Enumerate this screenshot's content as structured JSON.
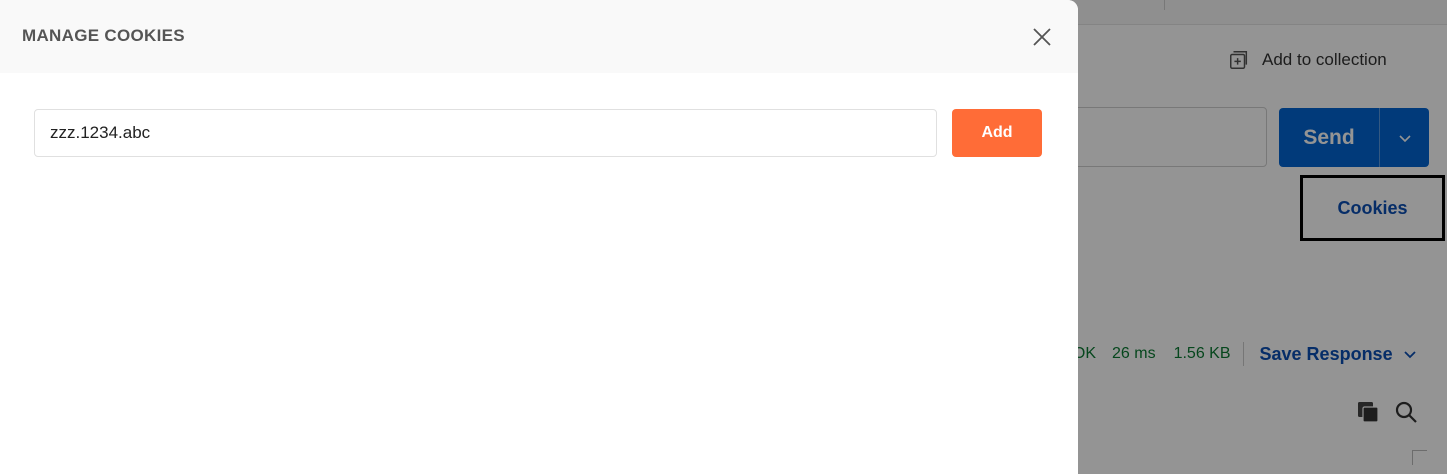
{
  "modal": {
    "title": "MANAGE COOKIES",
    "domain_input_value": "zzz.1234.abc",
    "add_label": "Add"
  },
  "background": {
    "add_to_collection_label": "Add to collection",
    "send_label": "Send",
    "cookies_label": "Cookies",
    "response": {
      "status": "OK",
      "time": "26 ms",
      "size": "1.56 KB",
      "save_response_label": "Save Response"
    }
  },
  "colors": {
    "accent_orange": "#ff6c37",
    "send_blue": "#0265d2",
    "link_blue": "#0b4fb3",
    "success_green": "#0b7a33"
  },
  "icons": {
    "close": "close-icon",
    "add_to_collection": "collection-add-icon",
    "send_dropdown": "chevron-down-icon",
    "save_response_dropdown": "chevron-down-icon",
    "copy": "copy-icon",
    "search": "search-icon"
  }
}
